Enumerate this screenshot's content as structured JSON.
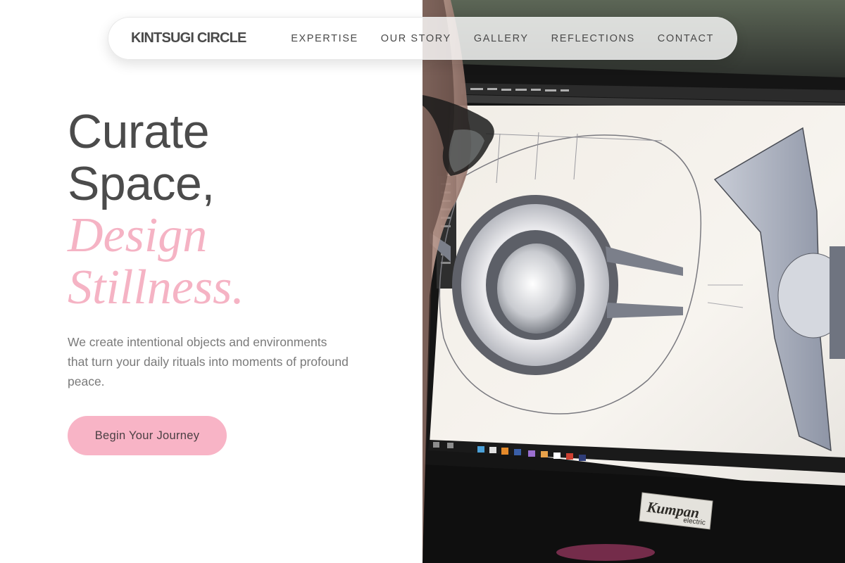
{
  "nav": {
    "brand": "KINTSUGI CIRCLE",
    "links": [
      {
        "label": "EXPERTISE"
      },
      {
        "label": "OUR STORY"
      },
      {
        "label": "GALLERY"
      },
      {
        "label": "REFLECTIONS"
      },
      {
        "label": "CONTACT"
      }
    ]
  },
  "hero": {
    "headline_line1": "Curate",
    "headline_line2": "Space,",
    "accent_line1": "Design",
    "accent_line2": "Stillness.",
    "subtitle": "We create intentional objects and environments that turn your daily rituals into moments of profound peace.",
    "cta_label": "Begin Your Journey"
  },
  "photo": {
    "monitor_brand": "Kumpan",
    "monitor_sub": "electric"
  },
  "colors": {
    "accent_pink": "#f5b3c4",
    "button_pink": "#f8b4c6",
    "text_dark": "#4b4b4b",
    "text_muted": "#7a7a7a"
  }
}
